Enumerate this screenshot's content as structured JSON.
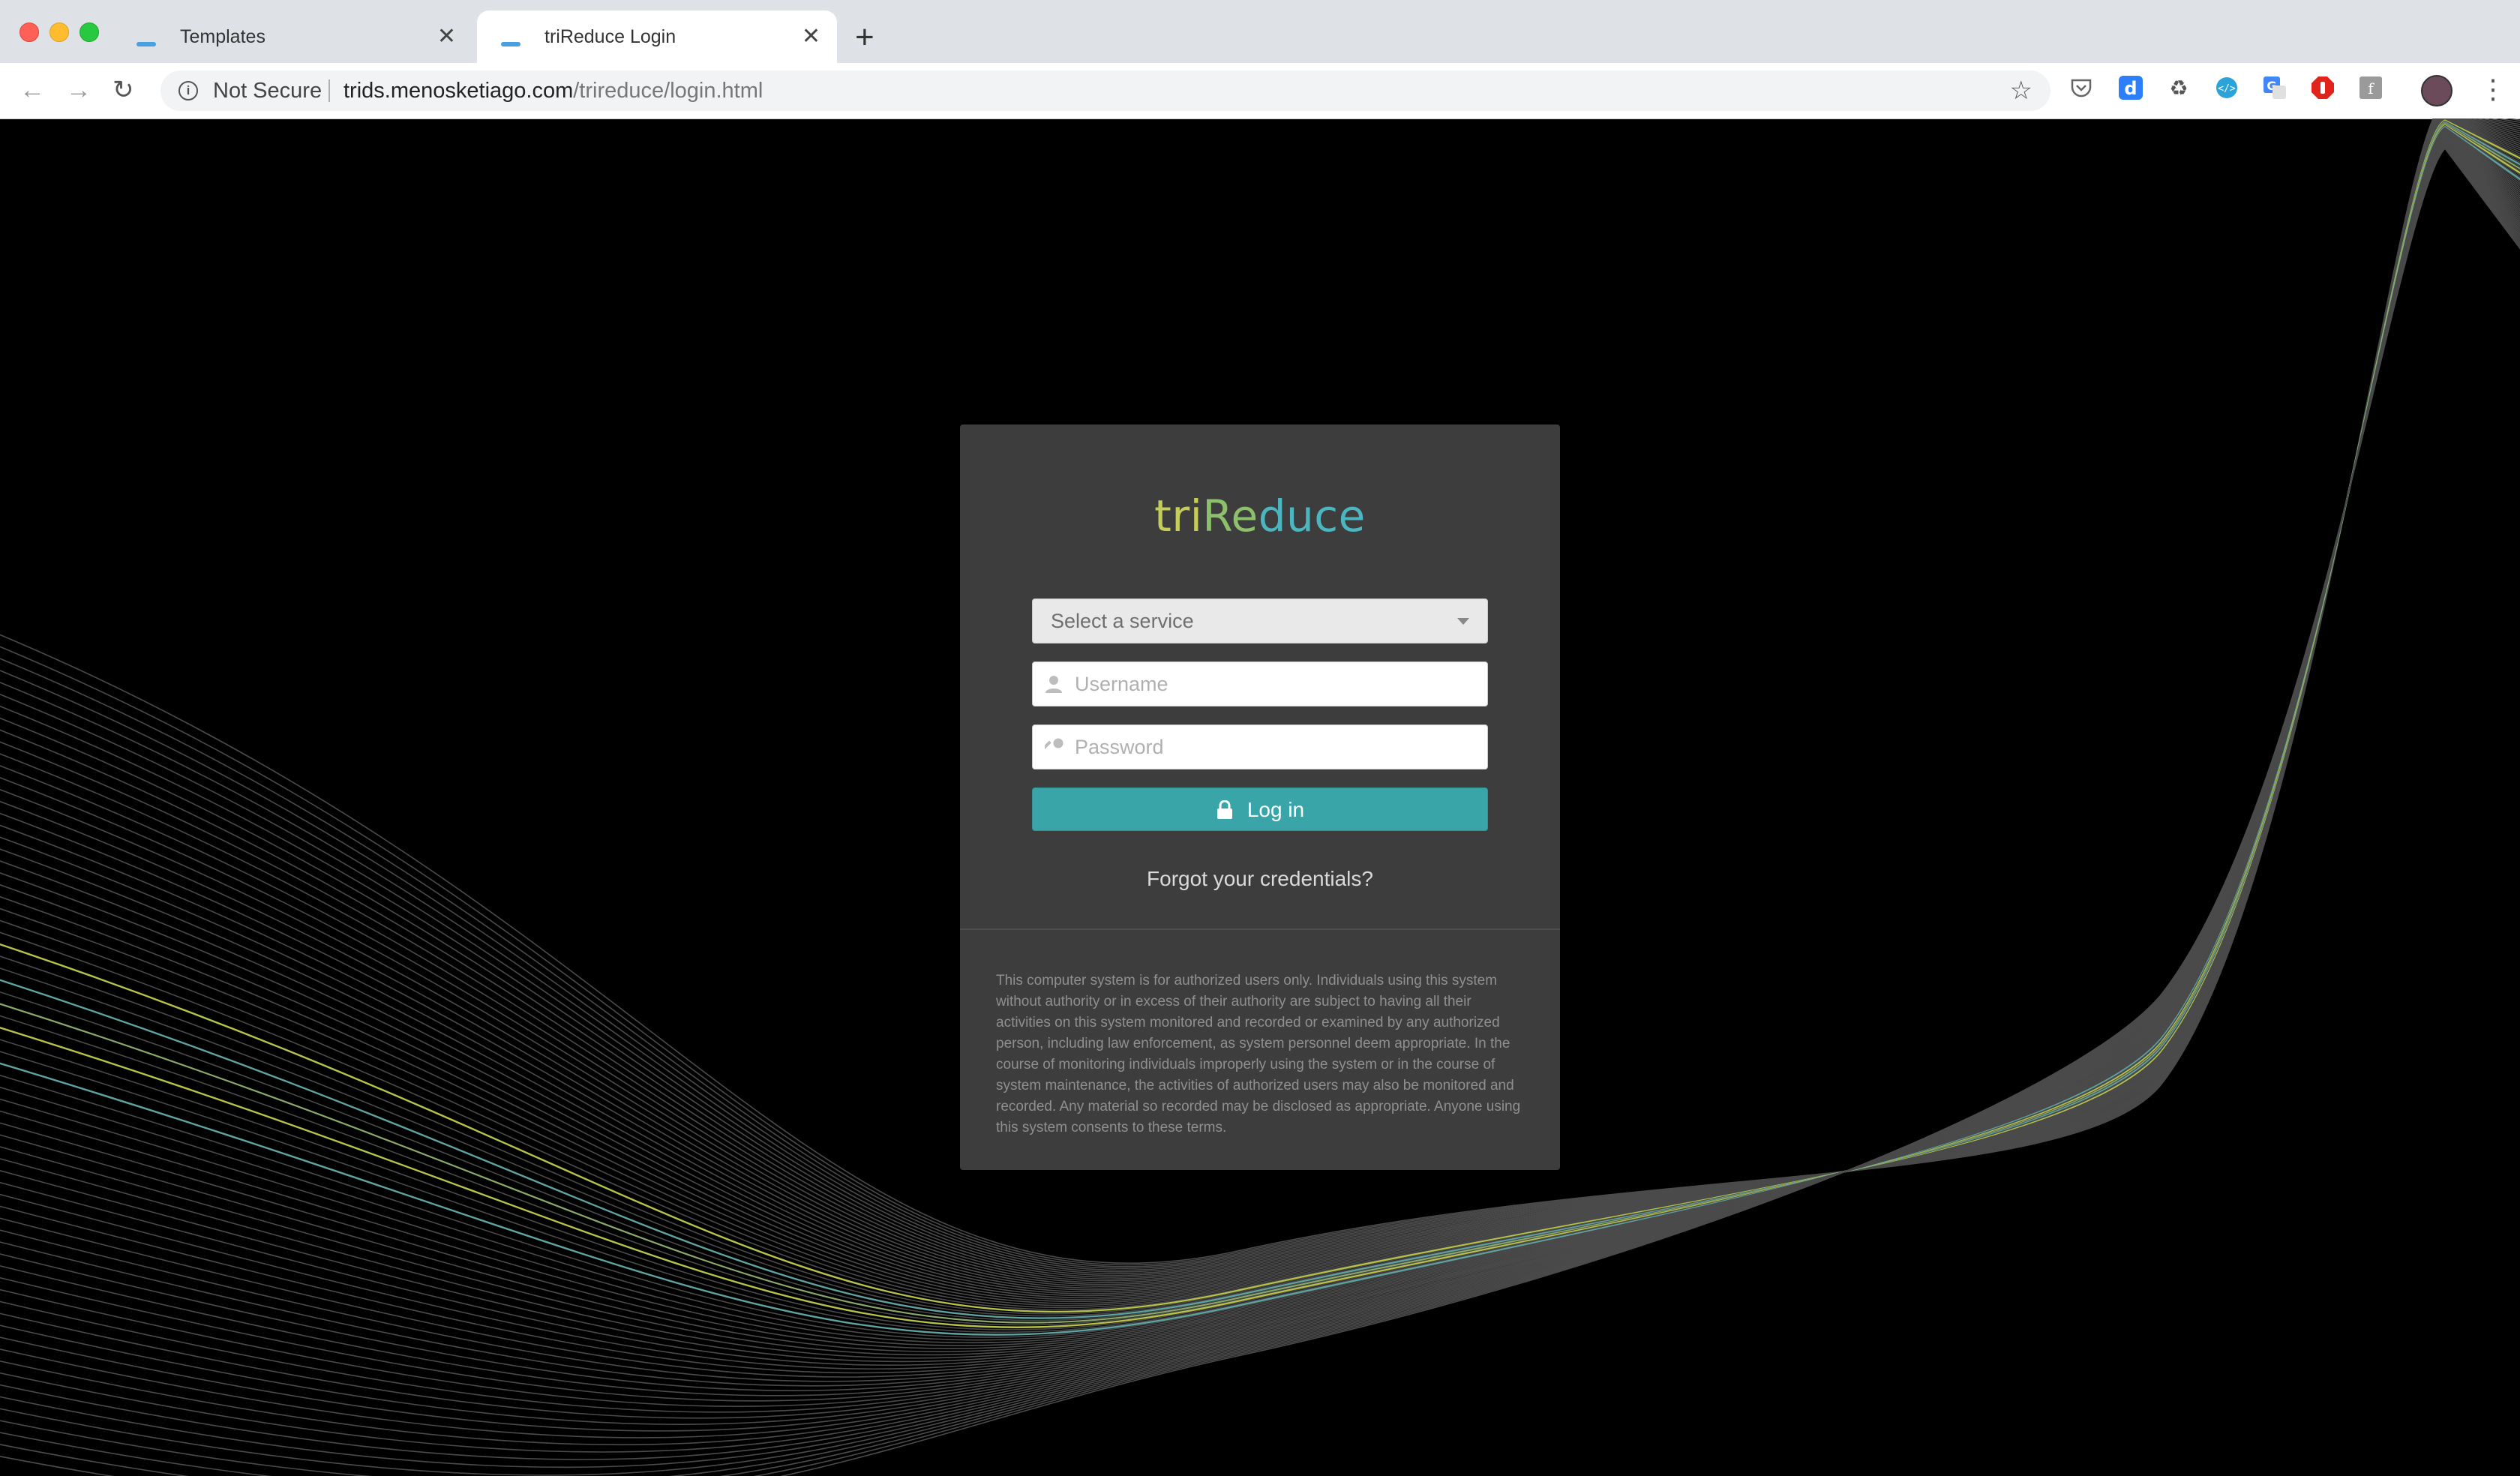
{
  "browser": {
    "tabs": [
      {
        "title": "Templates",
        "active": false
      },
      {
        "title": "triReduce Login",
        "active": true
      }
    ],
    "security_label": "Not Secure",
    "url_host": "trids.menosketiago.com",
    "url_path": "/trireduce/login.html",
    "extensions": [
      "pocket-icon",
      "d-extension-icon",
      "recycle-icon",
      "devtools-icon",
      "translate-icon",
      "adblock-icon",
      "font-icon"
    ]
  },
  "login": {
    "logo_part1": "tri",
    "logo_part2": "Re",
    "logo_part3": "duce",
    "service_placeholder": "Select a service",
    "username_placeholder": "Username",
    "password_placeholder": "Password",
    "login_label": "Log in",
    "forgot_label": "Forgot your credentials?",
    "disclaimer": "This computer system is for authorized users only. Individuals using this system without authority or in excess of their authority are subject to having all their activities on this system monitored and recorded or examined by any authorized person, including law enforcement, as system personnel deem appropriate. In the course of monitoring individuals improperly using the system or in the course of system maintenance, the activities of authorized users may also be monitored and recorded. Any material so recorded may be disclosed as appropriate. Anyone using this system consents to these terms."
  },
  "colors": {
    "accent": "#3aa5a8",
    "logo_yellow": "#c4cc5a",
    "logo_green": "#8dc06a",
    "logo_teal": "#4bb6bf",
    "card_bg": "#3d3d3d"
  }
}
